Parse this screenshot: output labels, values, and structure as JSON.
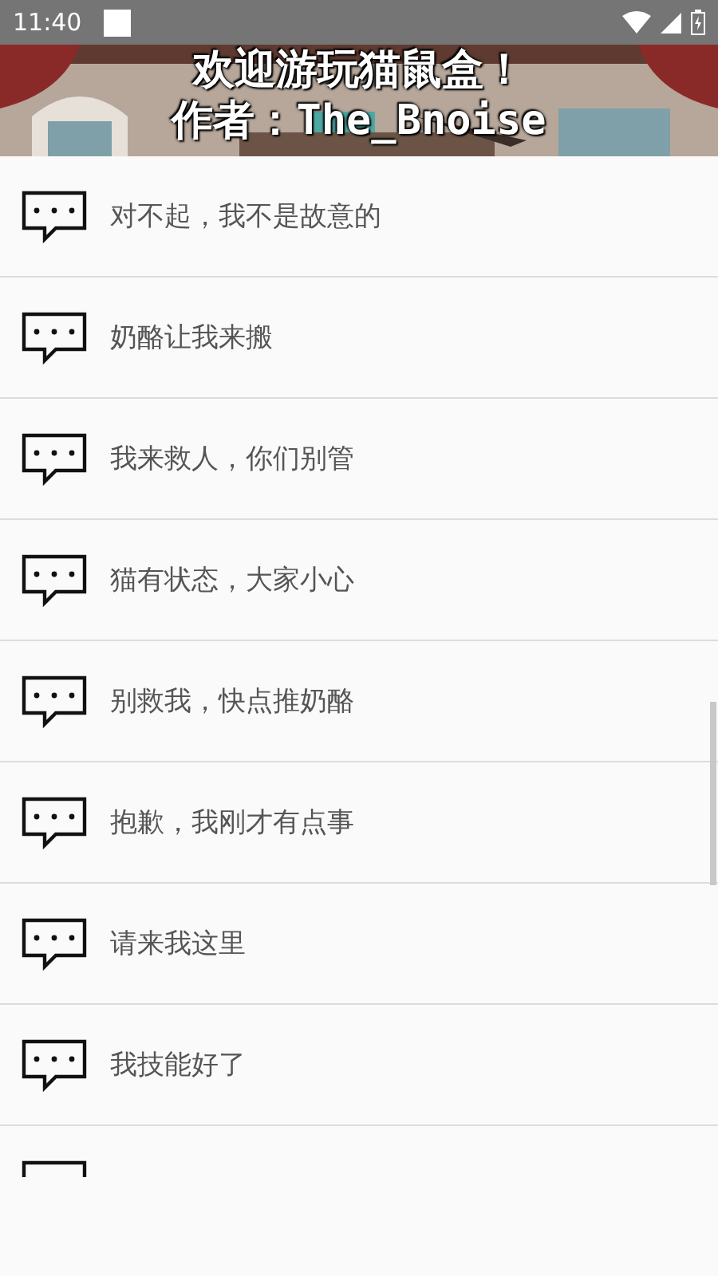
{
  "status_bar": {
    "time": "11:40"
  },
  "header": {
    "title": "欢迎游玩猫鼠盒！",
    "author": "作者：The_Bnoise"
  },
  "messages": [
    "对不起，我不是故意的",
    "奶酪让我来搬",
    "我来救人，你们别管",
    "猫有状态，大家小心",
    "别救我，快点推奶酪",
    "抱歉，我刚才有点事",
    "请来我这里",
    "我技能好了"
  ]
}
